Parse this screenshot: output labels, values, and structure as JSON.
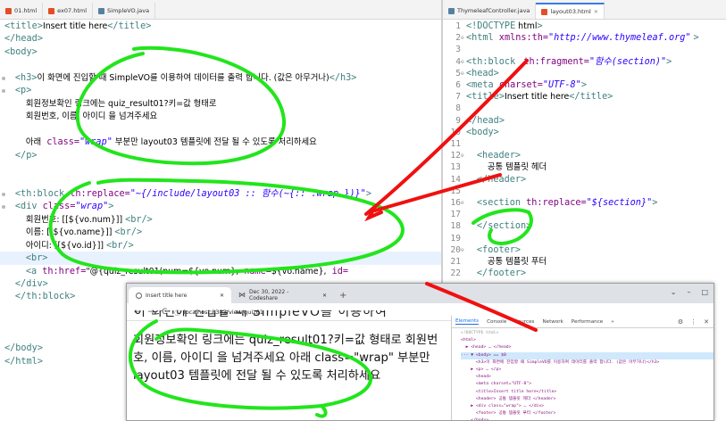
{
  "left_tabs": [
    {
      "label": "01.html",
      "kind": "html",
      "active": false
    },
    {
      "label": "ex07.html",
      "kind": "html",
      "active": false
    },
    {
      "label": "SimpleVO.java",
      "kind": "java",
      "active": false
    }
  ],
  "right_tabs": [
    {
      "label": "ThymeleafController.java",
      "kind": "java",
      "active": false
    },
    {
      "label": "layout03.html",
      "kind": "html",
      "active": true
    }
  ],
  "left_editor": {
    "lines": [
      "<title>Insert title here</title>",
      "</head>",
      "<body>",
      "",
      "    <h3>이 화면에 진입할 때 SimpleVO를 이용하여 데이터를 출력 합니다. (값은 아무거나)</h3>",
      "    <p>",
      "        회원정보확인 링크에는 quiz_result01?키=값 형태로",
      "        회원번호, 이름, 아이디 을 넘겨주세요",
      "",
      "        아래 class=\"wrap\" 부분만 layout03 템플릿에 전달 될 수 있도록 처리하세요",
      "    </p>",
      "",
      "",
      "    <th:block th:replace=\"~{/include/layout03 :: 함수(~{:: .wrap })}\">",
      "    <div class=\"wrap\">",
      "        회원번호: [[${vo.num}]] <br/>",
      "        이름: [[${vo.name}]] <br/>",
      "        아이디: [[${vo.id}]] <br/>",
      "        <br>",
      "        <a th:href=\"@{quiz_result01(num=${vo.num}, name=${vo.name}, id=",
      "    </div>",
      "    </th:block>",
      "",
      "",
      "",
      "</body>",
      "</html>"
    ]
  },
  "right_editor": {
    "lines": [
      {
        "n": "1",
        "text": "<!DOCTYPE html>"
      },
      {
        "n": "2",
        "text": "<html xmlns:th=\"http://www.thymeleaf.org\" >"
      },
      {
        "n": "3",
        "text": ""
      },
      {
        "n": "4",
        "text": "<th:block  th:fragment=\"함수(section)\">"
      },
      {
        "n": "5",
        "text": "<head>"
      },
      {
        "n": "6",
        "text": "<meta charset=\"UTF-8\">"
      },
      {
        "n": "7",
        "text": "<title>Insert title here</title>"
      },
      {
        "n": "8",
        "text": ""
      },
      {
        "n": "9",
        "text": "</head>"
      },
      {
        "n": "10",
        "text": "<body>"
      },
      {
        "n": "11",
        "text": ""
      },
      {
        "n": "12",
        "text": "    <header>"
      },
      {
        "n": "13",
        "text": "        공통 템플릿 헤더"
      },
      {
        "n": "14",
        "text": "    </header>"
      },
      {
        "n": "15",
        "text": ""
      },
      {
        "n": "16",
        "text": "    <section th:replace=\"${section}\">"
      },
      {
        "n": "17",
        "text": ""
      },
      {
        "n": "18",
        "text": "    </section>"
      },
      {
        "n": "19",
        "text": ""
      },
      {
        "n": "20",
        "text": "    <footer>"
      },
      {
        "n": "21",
        "text": "        공통 템플릿 푸터"
      },
      {
        "n": "22",
        "text": "    </footer>"
      }
    ]
  },
  "browser": {
    "tabs": [
      {
        "label": "Insert title here",
        "active": true
      },
      {
        "label": "Dec 30, 2022 - Codeshare",
        "active": false
      }
    ],
    "new_tab": "+",
    "url": "localhost:8383/view/quiz01",
    "nav": {
      "back": "←",
      "forward": "→",
      "reload": "C",
      "info": "ⓘ"
    },
    "win": {
      "chevron": "⌄",
      "minimize": "–",
      "maximize": "□"
    },
    "cut_heading": "이 화면에 진입할 때 SimpleVO를 이용하여",
    "paragraph": "회원정보확인 링크에는 quiz_result01?키=값 형태로 회원번호, 이름, 아이디 을 넘겨주세요 아래 class=\"wrap\" 부분만 layout03 템플릿에 전달 될 수 있도록 처리하세요",
    "devtools": {
      "tabs": [
        "Elements",
        "Console",
        "Sources",
        "Network",
        "Performance",
        "»"
      ],
      "tree": [
        {
          "text": "<!DOCTYPE html>",
          "kind": "cm",
          "sel": false
        },
        {
          "text": "<html>",
          "kind": "tag",
          "sel": false
        },
        {
          "text": "  ▶ <head> … </head>",
          "kind": "tag",
          "sel": false
        },
        {
          "text": "··· ▼ <body> == $0",
          "kind": "tag",
          "sel": true
        },
        {
          "text": "      <h3>이 화면에 진입할 때 SimpleVO를 이용하여 데이터를 출력 합니다. (값은 아무거나)</h3>",
          "kind": "tag",
          "sel": false
        },
        {
          "text": "    ▶ <p> … </p>",
          "kind": "tag",
          "sel": false
        },
        {
          "text": "      <head>",
          "kind": "tag",
          "sel": false
        },
        {
          "text": "      <meta charset=\"UTF-8\">",
          "kind": "tag",
          "sel": false
        },
        {
          "text": "      <title>Insert title here</title>",
          "kind": "tag",
          "sel": false
        },
        {
          "text": "      <header> 공통 템플릿 헤더 </header>",
          "kind": "tag",
          "sel": false
        },
        {
          "text": "    ▶ <div class=\"wrap\"> … </div>",
          "kind": "tag",
          "sel": false
        },
        {
          "text": "      <footer> 공통 템플릿 푸터 </footer>",
          "kind": "tag",
          "sel": false
        },
        {
          "text": "    </body>",
          "kind": "tag",
          "sel": false
        },
        {
          "text": "</html>",
          "kind": "tag",
          "sel": false
        }
      ]
    }
  },
  "annotation_colors": {
    "green": "#22e51c",
    "red": "#f01010"
  }
}
